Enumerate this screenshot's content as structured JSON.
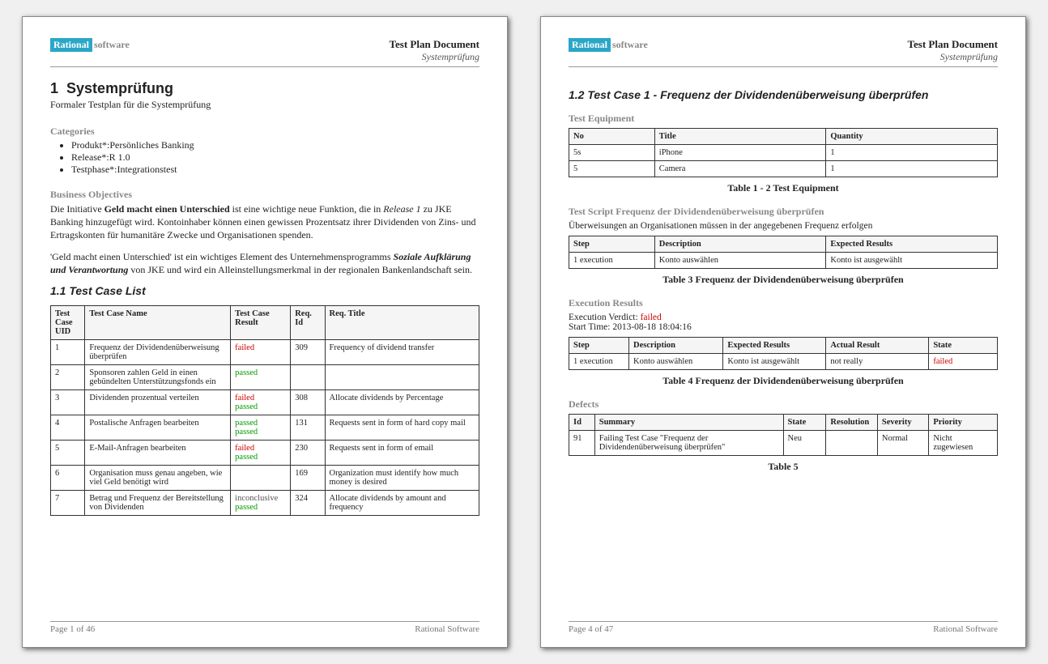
{
  "header": {
    "logo_left": "Rational",
    "logo_right": "software",
    "doc_title": "Test Plan Document",
    "doc_subtitle": "Systemprüfung"
  },
  "footer": {
    "page1": "Page 1 of  46",
    "page2": "Page 4 of  47",
    "company": "Rational Software"
  },
  "page1": {
    "section_num": "1",
    "section_title": "Systemprüfung",
    "section_sub": "Formaler Testplan für die Systemprüfung",
    "categories_head": "Categories",
    "categories": [
      "Produkt*:Persönliches Banking",
      "Release*:R 1.0",
      "Testphase*:Integrationstest"
    ],
    "bo_head": "Business Objectives",
    "bo_p1_a": "Die Initiative ",
    "bo_p1_b": "Geld macht einen Unterschied",
    "bo_p1_c": " ist eine wichtige neue Funktion, die in ",
    "bo_p1_d": "Release 1",
    "bo_p1_e": " zu JKE Banking hinzugefügt wird. Kontoinhaber können einen gewissen Prozentsatz ihrer Dividenden von Zins- und Ertragskonten für humanitäre Zwecke und Organisationen spenden.",
    "bo_p2_a": "'Geld macht einen Unterschied' ist ein wichtiges Element des Unternehmensprogramms ",
    "bo_p2_b": "Soziale Aufklärung und Verantwortung",
    "bo_p2_c": " von JKE und wird ein Alleinstellungsmerkmal in der regionalen Bankenlandschaft sein.",
    "subsec": "1.1  Test Case List",
    "tc_table": {
      "headers": [
        "Test Case UID",
        "Test Case Name",
        "Test Case Result",
        "Req. Id",
        "Req. Title"
      ],
      "rows": [
        {
          "uid": "1",
          "name": "Frequenz der Dividendenüberweisung überprüfen",
          "results": [
            "failed"
          ],
          "req_id": "309",
          "req_title": "Frequency of dividend transfer"
        },
        {
          "uid": "2",
          "name": "Sponsoren zahlen Geld in einen gebündelten Unterstützungsfonds ein",
          "results": [
            "passed"
          ],
          "req_id": "",
          "req_title": ""
        },
        {
          "uid": "3",
          "name": "Dividenden prozentual verteilen",
          "results": [
            "failed",
            "passed"
          ],
          "req_id": "308",
          "req_title": "Allocate dividends by Percentage"
        },
        {
          "uid": "4",
          "name": "Postalische Anfragen bearbeiten",
          "results": [
            "passed",
            "passed"
          ],
          "req_id": "131",
          "req_title": "Requests sent in form of hard copy mail"
        },
        {
          "uid": "5",
          "name": "E-Mail-Anfragen bearbeiten",
          "results": [
            "failed",
            "passed"
          ],
          "req_id": "230",
          "req_title": "Requests sent in form of email"
        },
        {
          "uid": "6",
          "name": "Organisation muss genau angeben, wie viel Geld benötigt wird",
          "results": [],
          "req_id": "169",
          "req_title": "Organization must identify how much money is desired"
        },
        {
          "uid": "7",
          "name": "Betrag und Frequenz der Bereitstellung von Dividenden",
          "results": [
            "inconclusive",
            "passed"
          ],
          "req_id": "324",
          "req_title": "Allocate dividends by amount and frequency"
        }
      ]
    }
  },
  "page2": {
    "subsec": "1.2  Test Case 1 - Frequenz der Dividendenüberweisung überprüfen",
    "equipment_head": "Test Equipment",
    "equipment": {
      "headers": [
        "No",
        "Title",
        "Quantity"
      ],
      "rows": [
        {
          "no": "5s",
          "title": "iPhone",
          "qty": "1"
        },
        {
          "no": "5",
          "title": "Camera",
          "qty": "1"
        }
      ]
    },
    "equipment_caption": "Table 1 - 2 Test Equipment",
    "ts_head": "Test Script Frequenz der Dividendenüberweisung überprüfen",
    "ts_sub": "Überweisungen an Organisationen müssen in der angegebenen Frequenz erfolgen",
    "ts_table": {
      "headers": [
        "Step",
        "Description",
        "Expected Results"
      ],
      "rows": [
        {
          "step": "1 execution",
          "desc": "Konto auswählen",
          "exp": "Konto ist ausgewählt"
        }
      ]
    },
    "ts_caption": "Table 3 Frequenz der Dividendenüberweisung überprüfen",
    "er_head": "Execution Results",
    "er_verdict_label": "Execution Verdict: ",
    "er_verdict": "failed",
    "er_start": "Start Time: 2013-08-18 18:04:16",
    "er_table": {
      "headers": [
        "Step",
        "Description",
        "Expected Results",
        "Actual Result",
        "State"
      ],
      "rows": [
        {
          "step": "1 execution",
          "desc": "Konto auswählen",
          "exp": "Konto ist ausgewählt",
          "act": "not really",
          "state": "failed"
        }
      ]
    },
    "er_caption": "Table 4 Frequenz der Dividendenüberweisung überprüfen",
    "def_head": "Defects",
    "def_table": {
      "headers": [
        "Id",
        "Summary",
        "State",
        "Resolution",
        "Severity",
        "Priority"
      ],
      "rows": [
        {
          "id": "91",
          "summary": "Failing Test Case \"Frequenz der Dividendenüberweisung überprüfen\"",
          "state": "Neu",
          "resolution": "",
          "severity": "Normal",
          "priority": "Nicht zugewiesen"
        }
      ]
    },
    "def_caption": "Table 5"
  }
}
